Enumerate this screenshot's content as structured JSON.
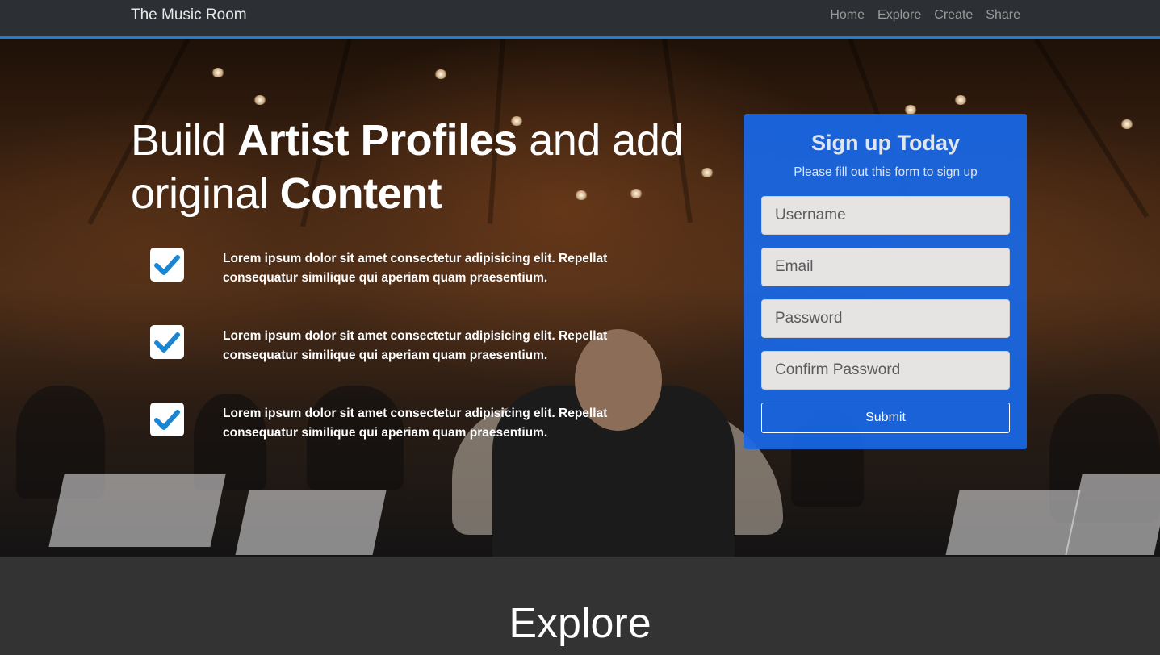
{
  "nav": {
    "brand": "The Music Room",
    "links": [
      "Home",
      "Explore",
      "Create",
      "Share"
    ]
  },
  "hero": {
    "headline": [
      {
        "text": "Build ",
        "bold": false
      },
      {
        "text": "Artist Profiles",
        "bold": true
      },
      {
        "text": " and add original ",
        "bold": false
      },
      {
        "text": "Content",
        "bold": true
      }
    ],
    "features": [
      "Lorem ipsum dolor sit amet consectetur adipisicing elit. Repellat consequatur similique qui aperiam quam praesentium.",
      "Lorem ipsum dolor sit amet consectetur adipisicing elit. Repellat consequatur similique qui aperiam quam praesentium.",
      "Lorem ipsum dolor sit amet consectetur adipisicing elit. Repellat consequatur similique qui aperiam quam praesentium."
    ]
  },
  "signup": {
    "title": "Sign up Today",
    "subtitle": "Please fill out this form to sign up",
    "username_placeholder": "Username",
    "email_placeholder": "Email",
    "password_placeholder": "Password",
    "confirm_placeholder": "Confirm Password",
    "submit_label": "Submit"
  },
  "explore": {
    "title": "Explore"
  },
  "colors": {
    "accent": "#1d7fd1",
    "signup_bg": "#1868e8",
    "check": "#1a86d1"
  }
}
